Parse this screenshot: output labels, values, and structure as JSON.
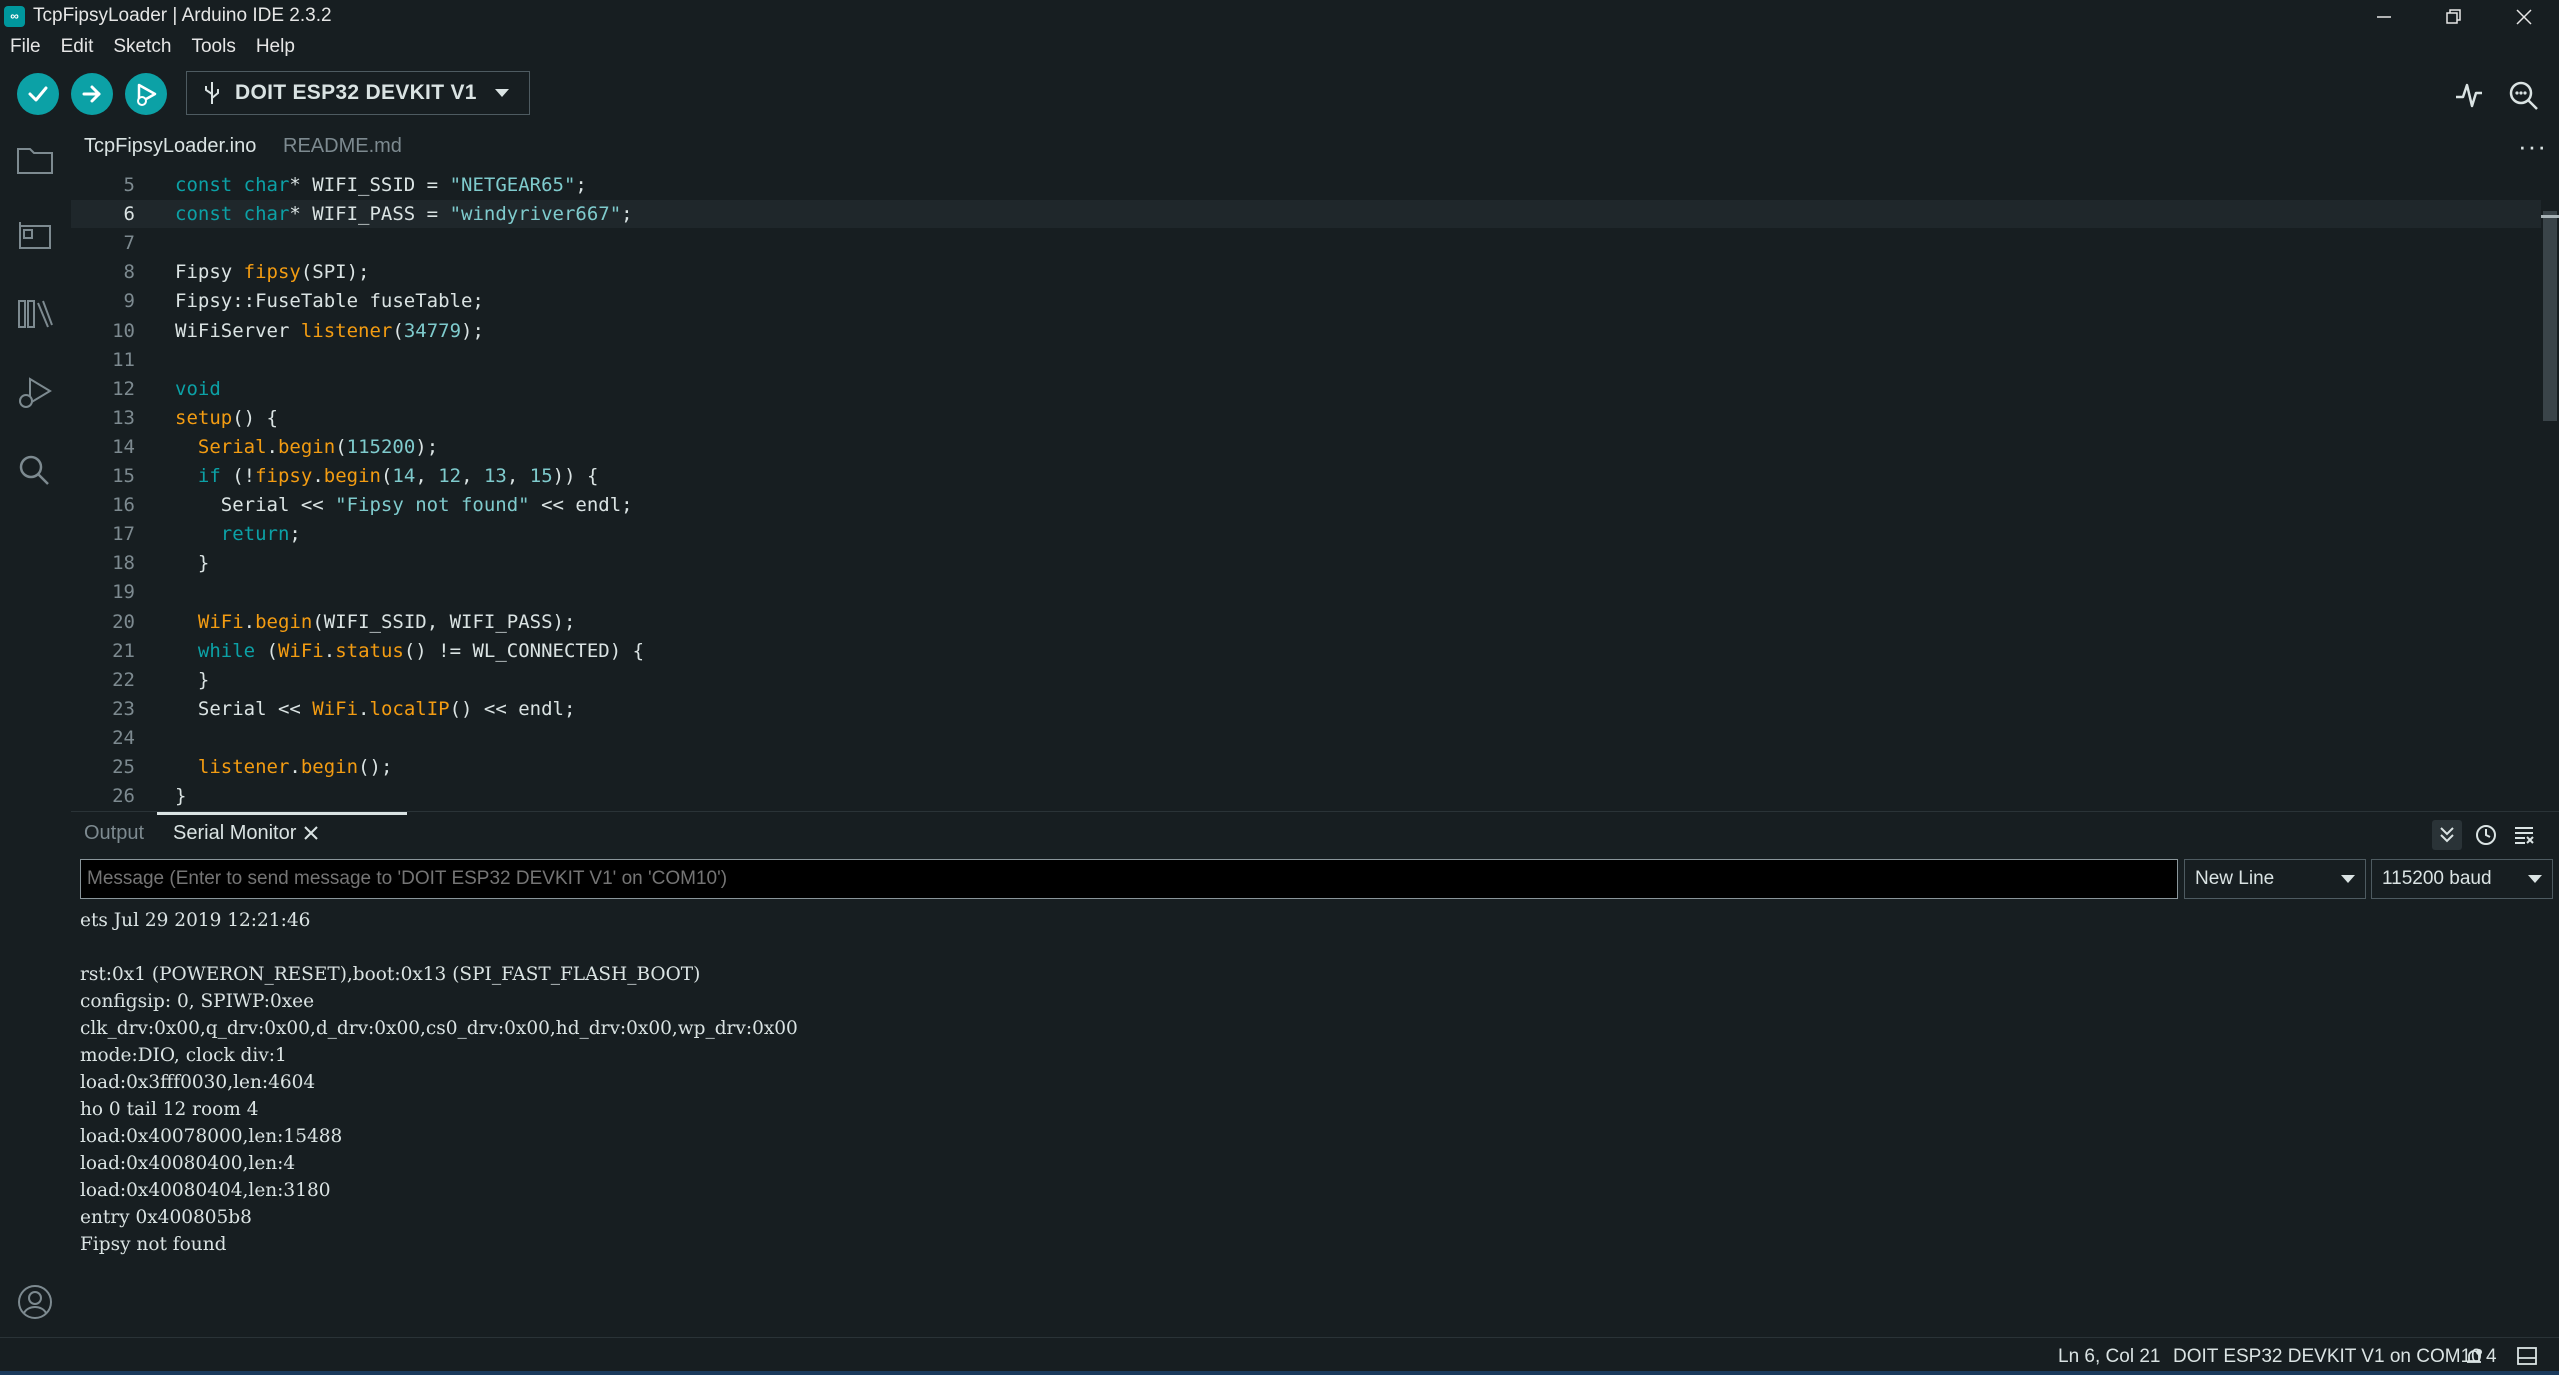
{
  "window": {
    "title": "TcpFipsyLoader | Arduino IDE 2.3.2",
    "app_icon": "arduino-logo-icon",
    "controls": [
      "minimize-icon",
      "restore-icon",
      "close-icon"
    ]
  },
  "menubar": {
    "items": [
      "File",
      "Edit",
      "Sketch",
      "Tools",
      "Help"
    ]
  },
  "toolbar": {
    "verify_icon": "check-icon",
    "upload_icon": "arrow-right-icon",
    "debug_icon": "debugger-icon",
    "board": "DOIT ESP32 DEVKIT V1",
    "board_icon": "usb-icon",
    "serial_plotter_icon": "pulse-icon",
    "serial_monitor_icon": "magnifier-dots-icon"
  },
  "sidebar": {
    "items": [
      "folder-icon",
      "board-manager-icon",
      "library-icon",
      "debug-icon",
      "search-icon"
    ],
    "account_icon": "account-icon"
  },
  "tabs": [
    {
      "label": "TcpFipsyLoader.ino",
      "active": true
    },
    {
      "label": "README.md",
      "active": false
    }
  ],
  "editor": {
    "active_line": 6,
    "lines": [
      {
        "n": "5",
        "t": [
          [
            "kw",
            "const "
          ],
          [
            "kw",
            "char"
          ],
          [
            "plain",
            "* WIFI_SSID = "
          ],
          [
            "str",
            "\"NETGEAR65\""
          ],
          [
            "plain",
            ";"
          ]
        ]
      },
      {
        "n": "6",
        "t": [
          [
            "kw",
            "const "
          ],
          [
            "kw",
            "char"
          ],
          [
            "plain",
            "* WIFI_PASS = "
          ],
          [
            "str",
            "\"windyriver667\""
          ],
          [
            "plain",
            ";"
          ]
        ]
      },
      {
        "n": "7",
        "t": []
      },
      {
        "n": "8",
        "t": [
          [
            "plain",
            "Fipsy "
          ],
          [
            "fn",
            "fipsy"
          ],
          [
            "plain",
            "(SPI);"
          ]
        ]
      },
      {
        "n": "9",
        "t": [
          [
            "plain",
            "Fipsy::FuseTable fuseTable;"
          ]
        ]
      },
      {
        "n": "10",
        "t": [
          [
            "plain",
            "WiFiServer "
          ],
          [
            "fn",
            "listener"
          ],
          [
            "plain",
            "("
          ],
          [
            "num",
            "34779"
          ],
          [
            "plain",
            ");"
          ]
        ]
      },
      {
        "n": "11",
        "t": []
      },
      {
        "n": "12",
        "t": [
          [
            "kw",
            "void"
          ]
        ]
      },
      {
        "n": "13",
        "t": [
          [
            "fn",
            "setup"
          ],
          [
            "plain",
            "() {"
          ]
        ]
      },
      {
        "n": "14",
        "t": [
          [
            "plain",
            "  "
          ],
          [
            "fn",
            "Serial"
          ],
          [
            "plain",
            "."
          ],
          [
            "fn",
            "begin"
          ],
          [
            "plain",
            "("
          ],
          [
            "num",
            "115200"
          ],
          [
            "plain",
            ");"
          ]
        ]
      },
      {
        "n": "15",
        "t": [
          [
            "plain",
            "  "
          ],
          [
            "kw",
            "if"
          ],
          [
            "plain",
            " (!"
          ],
          [
            "fn",
            "fipsy"
          ],
          [
            "plain",
            "."
          ],
          [
            "fn",
            "begin"
          ],
          [
            "plain",
            "("
          ],
          [
            "num",
            "14"
          ],
          [
            "plain",
            ", "
          ],
          [
            "num",
            "12"
          ],
          [
            "plain",
            ", "
          ],
          [
            "num",
            "13"
          ],
          [
            "plain",
            ", "
          ],
          [
            "num",
            "15"
          ],
          [
            "plain",
            ")) {"
          ]
        ]
      },
      {
        "n": "16",
        "t": [
          [
            "plain",
            "    Serial << "
          ],
          [
            "str",
            "\"Fipsy not found\""
          ],
          [
            "plain",
            " << endl;"
          ]
        ]
      },
      {
        "n": "17",
        "t": [
          [
            "plain",
            "    "
          ],
          [
            "kw",
            "return"
          ],
          [
            "plain",
            ";"
          ]
        ]
      },
      {
        "n": "18",
        "t": [
          [
            "plain",
            "  }"
          ]
        ]
      },
      {
        "n": "19",
        "t": []
      },
      {
        "n": "20",
        "t": [
          [
            "plain",
            "  "
          ],
          [
            "fn",
            "WiFi"
          ],
          [
            "plain",
            "."
          ],
          [
            "fn",
            "begin"
          ],
          [
            "plain",
            "(WIFI_SSID, WIFI_PASS);"
          ]
        ]
      },
      {
        "n": "21",
        "t": [
          [
            "plain",
            "  "
          ],
          [
            "kw",
            "while"
          ],
          [
            "plain",
            " ("
          ],
          [
            "fn",
            "WiFi"
          ],
          [
            "plain",
            "."
          ],
          [
            "fn",
            "status"
          ],
          [
            "plain",
            "() != WL_CONNECTED) {"
          ]
        ]
      },
      {
        "n": "22",
        "t": [
          [
            "plain",
            "  }"
          ]
        ]
      },
      {
        "n": "23",
        "t": [
          [
            "plain",
            "  Serial << "
          ],
          [
            "fn",
            "WiFi"
          ],
          [
            "plain",
            "."
          ],
          [
            "fn",
            "localIP"
          ],
          [
            "plain",
            "() << endl;"
          ]
        ]
      },
      {
        "n": "24",
        "t": []
      },
      {
        "n": "25",
        "t": [
          [
            "plain",
            "  "
          ],
          [
            "fn",
            "listener"
          ],
          [
            "plain",
            "."
          ],
          [
            "fn",
            "begin"
          ],
          [
            "plain",
            "();"
          ]
        ]
      },
      {
        "n": "26",
        "t": [
          [
            "plain",
            "}"
          ]
        ]
      }
    ]
  },
  "panel": {
    "tabs": [
      {
        "label": "Output",
        "active": false
      },
      {
        "label": "Serial Monitor",
        "active": true
      }
    ],
    "close_icon": "close-icon",
    "tools": [
      "toggle-autoscroll-icon",
      "timestamp-clock-icon",
      "clear-output-icon"
    ],
    "message_placeholder": "Message (Enter to send message to 'DOIT ESP32 DEVKIT V1' on 'COM10')",
    "message_value": "",
    "line_ending": "New Line",
    "baud": "115200 baud",
    "output": [
      "ets Jul 29 2019 12:21:46",
      "",
      "rst:0x1 (POWERON_RESET),boot:0x13 (SPI_FAST_FLASH_BOOT)",
      "configsip: 0, SPIWP:0xee",
      "clk_drv:0x00,q_drv:0x00,d_drv:0x00,cs0_drv:0x00,hd_drv:0x00,wp_drv:0x00",
      "mode:DIO, clock div:1",
      "load:0x3fff0030,len:4604",
      "ho 0 tail 12 room 4",
      "load:0x40078000,len:15488",
      "load:0x40080400,len:4",
      "load:0x40080404,len:3180",
      "entry 0x400805b8",
      "Fipsy not found"
    ]
  },
  "status": {
    "cursor": "Ln 6, Col 21",
    "board_port": "DOIT ESP32 DEVKIT V1 on COM10",
    "notifications": "4",
    "notification_icon": "bell-icon",
    "panel_toggle_icon": "panel-toggle-icon"
  },
  "colors": {
    "background": "#171e21",
    "accent": "#0ca1a6",
    "function": "#f39c12",
    "text": "#dae3e3"
  }
}
